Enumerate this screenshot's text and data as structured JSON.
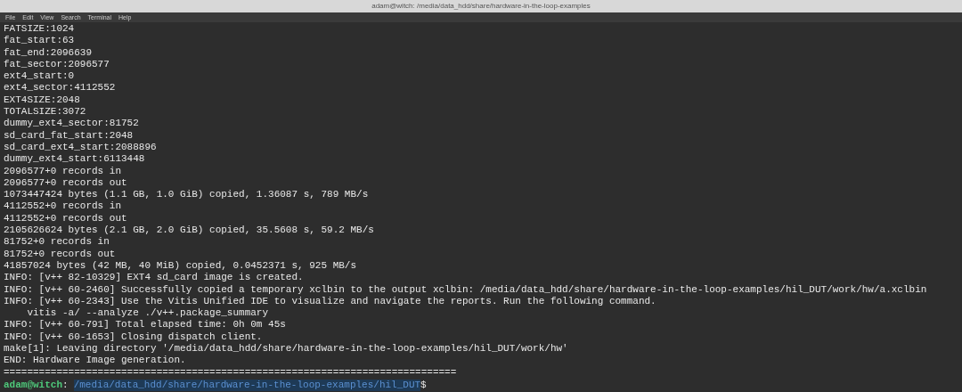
{
  "window": {
    "title": "adam@witch: /media/data_hdd/share/hardware-in-the-loop-examples"
  },
  "menu": [
    "File",
    "Edit",
    "View",
    "Search",
    "Terminal",
    "Help"
  ],
  "output_lines": [
    "FATSIZE:1024",
    "fat_start:63",
    "fat_end:2096639",
    "fat_sector:2096577",
    "ext4_start:0",
    "ext4_sector:4112552",
    "EXT4SIZE:2048",
    "TOTALSIZE:3072",
    "dummy_ext4_sector:81752",
    "sd_card_fat_start:2048",
    "sd_card_ext4_start:2088896",
    "dummy_ext4_start:6113448",
    "2096577+0 records in",
    "2096577+0 records out",
    "1073447424 bytes (1.1 GB, 1.0 GiB) copied, 1.36087 s, 789 MB/s",
    "4112552+0 records in",
    "4112552+0 records out",
    "2105626624 bytes (2.1 GB, 2.0 GiB) copied, 35.5608 s, 59.2 MB/s",
    "81752+0 records in",
    "81752+0 records out",
    "41857024 bytes (42 MB, 40 MiB) copied, 0.0452371 s, 925 MB/s",
    "INFO: [v++ 82-10329] EXT4 sd_card image is created.",
    "INFO: [v++ 60-2460] Successfully copied a temporary xclbin to the output xclbin: /media/data_hdd/share/hardware-in-the-loop-examples/hil_DUT/work/hw/a.xclbin",
    "INFO: [v++ 60-2343] Use the Vitis Unified IDE to visualize and navigate the reports. Run the following command.",
    "    vitis -a/ --analyze ./v++.package_summary",
    "INFO: [v++ 60-791] Total elapsed time: 0h 0m 45s",
    "INFO: [v++ 60-1653] Closing dispatch client.",
    "make[1]: Leaving directory '/media/data_hdd/share/hardware-in-the-loop-examples/hil_DUT/work/hw'",
    "END: Hardware Image generation.",
    "============================================================================="
  ],
  "prompt": {
    "user_host": "adam@witch",
    "separator": ":",
    "path": "/media/data_hdd/share/hardware-in-the-loop-examples/hil_DUT",
    "symbol": "$"
  }
}
